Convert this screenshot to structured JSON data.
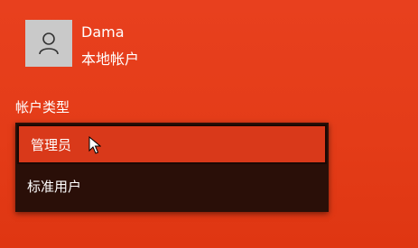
{
  "account": {
    "name": "Dama",
    "kind": "本地帐户",
    "avatar_icon": "user-icon"
  },
  "account_type": {
    "label": "帐户类型",
    "options": [
      "管理员",
      "标准用户"
    ],
    "selected": "管理员"
  },
  "colors": {
    "background": "#e43c18",
    "dropdown": "#2a0f08",
    "highlight": "#d9391a"
  }
}
